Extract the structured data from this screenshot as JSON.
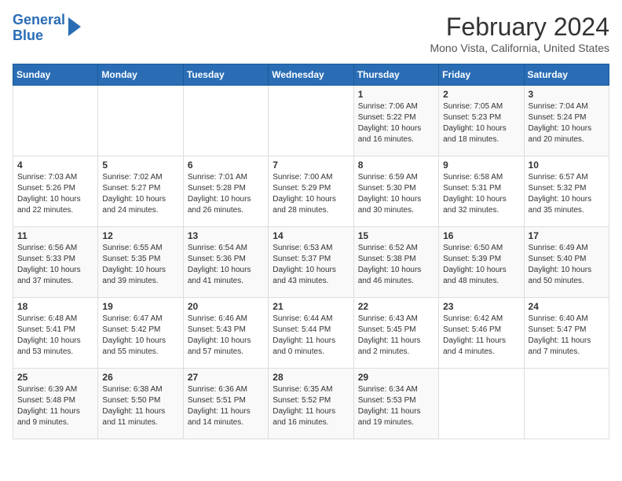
{
  "header": {
    "logo_line1": "General",
    "logo_line2": "Blue",
    "month_title": "February 2024",
    "location": "Mono Vista, California, United States"
  },
  "days_of_week": [
    "Sunday",
    "Monday",
    "Tuesday",
    "Wednesday",
    "Thursday",
    "Friday",
    "Saturday"
  ],
  "weeks": [
    [
      {
        "day": "",
        "content": ""
      },
      {
        "day": "",
        "content": ""
      },
      {
        "day": "",
        "content": ""
      },
      {
        "day": "",
        "content": ""
      },
      {
        "day": "1",
        "content": "Sunrise: 7:06 AM\nSunset: 5:22 PM\nDaylight: 10 hours\nand 16 minutes."
      },
      {
        "day": "2",
        "content": "Sunrise: 7:05 AM\nSunset: 5:23 PM\nDaylight: 10 hours\nand 18 minutes."
      },
      {
        "day": "3",
        "content": "Sunrise: 7:04 AM\nSunset: 5:24 PM\nDaylight: 10 hours\nand 20 minutes."
      }
    ],
    [
      {
        "day": "4",
        "content": "Sunrise: 7:03 AM\nSunset: 5:26 PM\nDaylight: 10 hours\nand 22 minutes."
      },
      {
        "day": "5",
        "content": "Sunrise: 7:02 AM\nSunset: 5:27 PM\nDaylight: 10 hours\nand 24 minutes."
      },
      {
        "day": "6",
        "content": "Sunrise: 7:01 AM\nSunset: 5:28 PM\nDaylight: 10 hours\nand 26 minutes."
      },
      {
        "day": "7",
        "content": "Sunrise: 7:00 AM\nSunset: 5:29 PM\nDaylight: 10 hours\nand 28 minutes."
      },
      {
        "day": "8",
        "content": "Sunrise: 6:59 AM\nSunset: 5:30 PM\nDaylight: 10 hours\nand 30 minutes."
      },
      {
        "day": "9",
        "content": "Sunrise: 6:58 AM\nSunset: 5:31 PM\nDaylight: 10 hours\nand 32 minutes."
      },
      {
        "day": "10",
        "content": "Sunrise: 6:57 AM\nSunset: 5:32 PM\nDaylight: 10 hours\nand 35 minutes."
      }
    ],
    [
      {
        "day": "11",
        "content": "Sunrise: 6:56 AM\nSunset: 5:33 PM\nDaylight: 10 hours\nand 37 minutes."
      },
      {
        "day": "12",
        "content": "Sunrise: 6:55 AM\nSunset: 5:35 PM\nDaylight: 10 hours\nand 39 minutes."
      },
      {
        "day": "13",
        "content": "Sunrise: 6:54 AM\nSunset: 5:36 PM\nDaylight: 10 hours\nand 41 minutes."
      },
      {
        "day": "14",
        "content": "Sunrise: 6:53 AM\nSunset: 5:37 PM\nDaylight: 10 hours\nand 43 minutes."
      },
      {
        "day": "15",
        "content": "Sunrise: 6:52 AM\nSunset: 5:38 PM\nDaylight: 10 hours\nand 46 minutes."
      },
      {
        "day": "16",
        "content": "Sunrise: 6:50 AM\nSunset: 5:39 PM\nDaylight: 10 hours\nand 48 minutes."
      },
      {
        "day": "17",
        "content": "Sunrise: 6:49 AM\nSunset: 5:40 PM\nDaylight: 10 hours\nand 50 minutes."
      }
    ],
    [
      {
        "day": "18",
        "content": "Sunrise: 6:48 AM\nSunset: 5:41 PM\nDaylight: 10 hours\nand 53 minutes."
      },
      {
        "day": "19",
        "content": "Sunrise: 6:47 AM\nSunset: 5:42 PM\nDaylight: 10 hours\nand 55 minutes."
      },
      {
        "day": "20",
        "content": "Sunrise: 6:46 AM\nSunset: 5:43 PM\nDaylight: 10 hours\nand 57 minutes."
      },
      {
        "day": "21",
        "content": "Sunrise: 6:44 AM\nSunset: 5:44 PM\nDaylight: 11 hours\nand 0 minutes."
      },
      {
        "day": "22",
        "content": "Sunrise: 6:43 AM\nSunset: 5:45 PM\nDaylight: 11 hours\nand 2 minutes."
      },
      {
        "day": "23",
        "content": "Sunrise: 6:42 AM\nSunset: 5:46 PM\nDaylight: 11 hours\nand 4 minutes."
      },
      {
        "day": "24",
        "content": "Sunrise: 6:40 AM\nSunset: 5:47 PM\nDaylight: 11 hours\nand 7 minutes."
      }
    ],
    [
      {
        "day": "25",
        "content": "Sunrise: 6:39 AM\nSunset: 5:48 PM\nDaylight: 11 hours\nand 9 minutes."
      },
      {
        "day": "26",
        "content": "Sunrise: 6:38 AM\nSunset: 5:50 PM\nDaylight: 11 hours\nand 11 minutes."
      },
      {
        "day": "27",
        "content": "Sunrise: 6:36 AM\nSunset: 5:51 PM\nDaylight: 11 hours\nand 14 minutes."
      },
      {
        "day": "28",
        "content": "Sunrise: 6:35 AM\nSunset: 5:52 PM\nDaylight: 11 hours\nand 16 minutes."
      },
      {
        "day": "29",
        "content": "Sunrise: 6:34 AM\nSunset: 5:53 PM\nDaylight: 11 hours\nand 19 minutes."
      },
      {
        "day": "",
        "content": ""
      },
      {
        "day": "",
        "content": ""
      }
    ]
  ]
}
